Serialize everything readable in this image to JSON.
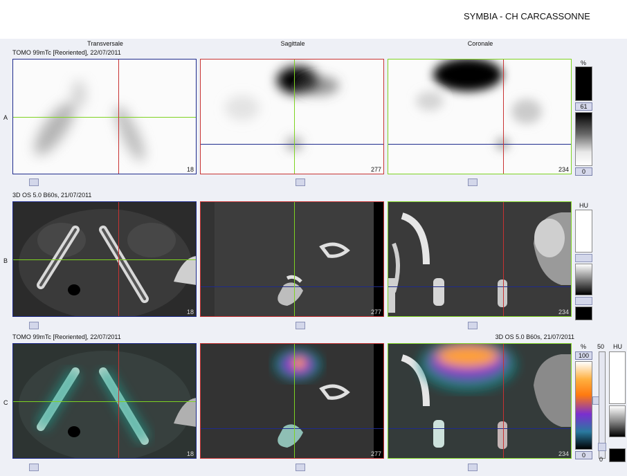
{
  "app": {
    "title": "SYMBIA - CH CARCASSONNE"
  },
  "columns": [
    "Transversale",
    "Sagittale",
    "Coronale"
  ],
  "rows": [
    {
      "label": "A",
      "series": "TOMO 99mTc [Reoriented], 22/07/2011",
      "slices": [
        "18",
        "277",
        "234"
      ]
    },
    {
      "label": "B",
      "series": "3D  OS  5.0  B60s, 21/07/2011",
      "slices": [
        "18",
        "277",
        "234"
      ]
    },
    {
      "label": "C",
      "series": "TOMO 99mTc [Reoriented], 22/07/2011",
      "series_right": "3D  OS  5.0  B60s, 21/07/2011",
      "slices": [
        "18",
        "277",
        "234"
      ]
    }
  ],
  "scales": {
    "nm": {
      "unit": "%",
      "level": "61",
      "min": "0"
    },
    "ct": {
      "unit": "HU"
    },
    "fusion": {
      "unit": "%",
      "max": "100",
      "min": "0",
      "blend_max": "50",
      "blend_min": "0",
      "ct_unit": "HU"
    }
  },
  "colors": {
    "transverse_border": "#1e2a8c",
    "sagittal_border": "#c83232",
    "coronal_border": "#7ed321"
  }
}
